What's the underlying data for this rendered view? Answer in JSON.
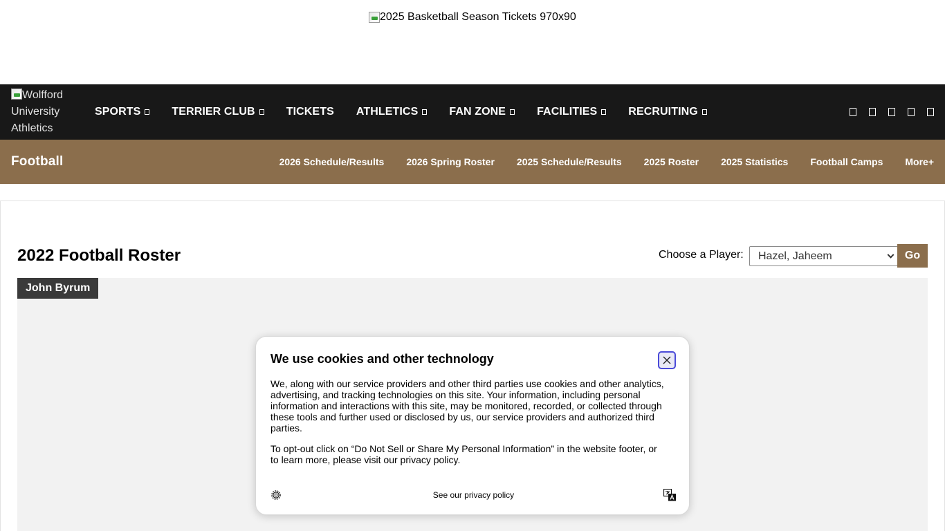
{
  "ad": {
    "alt": "2025 Basketball Season Tickets 970x90"
  },
  "header": {
    "logo_alt": "Wolfford University Athletics",
    "nav": [
      "SPORTS",
      "TERRIER CLUB",
      "TICKETS",
      "ATHLETICS",
      "FAN ZONE",
      "FACILITIES",
      "RECRUITING"
    ],
    "nav_has_dropdown": [
      true,
      true,
      false,
      true,
      true,
      true,
      true
    ]
  },
  "subnav": {
    "title": "Football",
    "items": [
      "2026 Schedule/Results",
      "2026 Spring Roster",
      "2025 Schedule/Results",
      "2025 Roster",
      "2025 Statistics",
      "Football Camps",
      "More+"
    ]
  },
  "roster": {
    "title": "2022 Football Roster",
    "choose_label": "Choose a Player:",
    "selected_player": "Hazel, Jaheem",
    "go_label": "Go",
    "player_name": "John Byrum"
  },
  "cookie": {
    "title": "We use cookies and other technology",
    "paragraph1": "We, along with our service providers and other third parties use cookies and other analytics, advertising, and tracking technologies on this site. Your information, including personal information and interactions with this site, may be monitored, recorded, or collected through these tools and further used or disclosed by us, our service providers and authorized third parties.",
    "paragraph2": "To opt-out click on “Do Not Sell or Share My Personal Information” in the website footer, or to learn more, please visit our privacy policy.",
    "privacy_link": "See our privacy policy"
  },
  "colors": {
    "brand_gold": "#8b6e4c",
    "nav_black": "#181818",
    "panel_gray": "#f2f2f2"
  },
  "icons": {
    "close": "close-icon",
    "settings": "gear-icon",
    "language": "translate-icon"
  }
}
